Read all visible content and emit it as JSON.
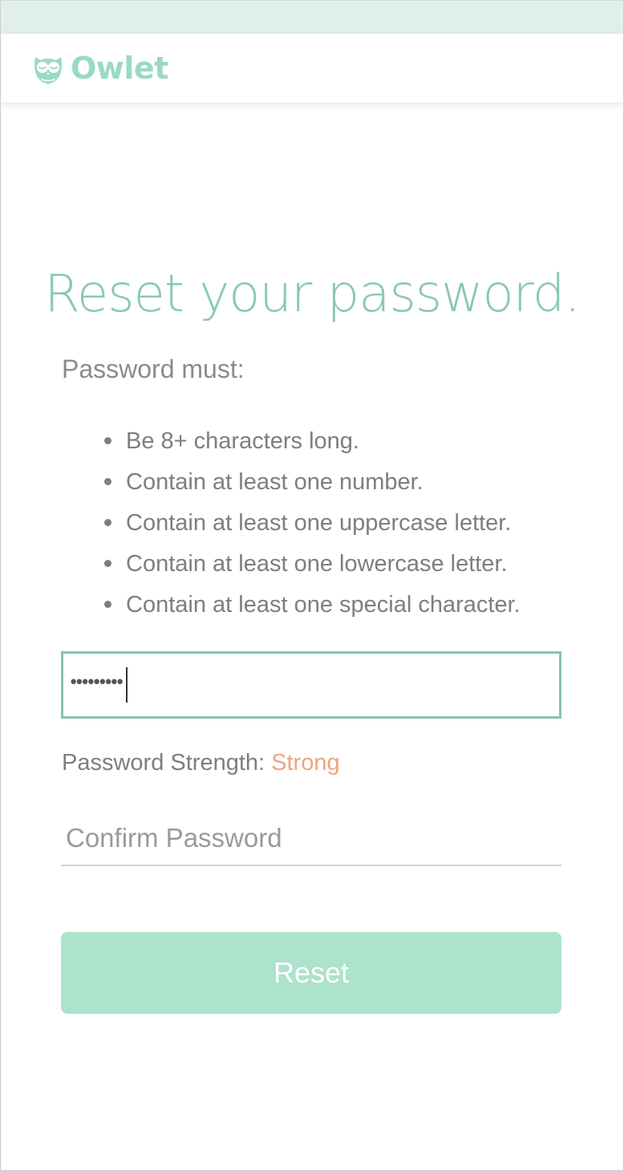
{
  "brand": {
    "name": "Owlet",
    "logo_icon": "owl-icon",
    "color": "#9adac1"
  },
  "page": {
    "title": "Reset your password."
  },
  "requirements": {
    "intro": "Password must:",
    "items": [
      "Be 8+ characters long.",
      "Contain at least one number.",
      "Contain at least one uppercase letter.",
      "Contain at least one lowercase letter.",
      "Contain at least one special character."
    ]
  },
  "password_field": {
    "masked_value": "•••••••••",
    "focused": true
  },
  "strength": {
    "label": "Password Strength:",
    "value": "Strong",
    "value_color": "#f0a37e"
  },
  "confirm_field": {
    "placeholder": "Confirm Password",
    "value": ""
  },
  "reset_button": {
    "label": "Reset"
  },
  "colors": {
    "accent": "#8ac8b0",
    "button": "#ade2cd",
    "top_strip": "#e0efe9"
  }
}
